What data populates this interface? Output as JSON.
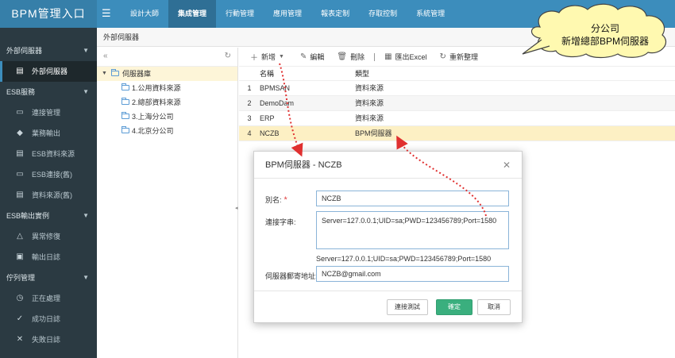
{
  "app": {
    "title": "BPM管理入口"
  },
  "topnav": [
    "設計大師",
    "集成管理",
    "行動管理",
    "應用管理",
    "報表定制",
    "存取控制",
    "系統管理"
  ],
  "sidebar": {
    "groups": [
      {
        "label": "外部伺服器",
        "items": [
          {
            "label": "外部伺服器",
            "icon": "database-icon",
            "active": true
          }
        ]
      },
      {
        "label": "ESB服務",
        "items": [
          {
            "label": "連接管理",
            "icon": "monitor-icon"
          },
          {
            "label": "業務輸出",
            "icon": "car-icon"
          },
          {
            "label": "ESB資料來源",
            "icon": "database-icon"
          },
          {
            "label": "ESB連接(舊)",
            "icon": "monitor-icon"
          },
          {
            "label": "資料來源(舊)",
            "icon": "database-icon"
          }
        ]
      },
      {
        "label": "ESB輸出實例",
        "items": [
          {
            "label": "異常修復",
            "icon": "warning-icon"
          },
          {
            "label": "輸出日誌",
            "icon": "log-icon"
          }
        ]
      },
      {
        "label": "佇列管理",
        "items": [
          {
            "label": "正在處理",
            "icon": "clock-icon"
          },
          {
            "label": "成功日誌",
            "icon": "check-icon"
          },
          {
            "label": "失敗日誌",
            "icon": "cross-icon"
          }
        ]
      }
    ]
  },
  "breadcrumb": "外部伺服器",
  "tree": {
    "root": "伺服器庫",
    "nodes": [
      "1.公用資料來源",
      "2.總部資料來源",
      "3.上海分公司",
      "4.北京分公司"
    ]
  },
  "toolbar": {
    "new": "新增",
    "edit": "編輯",
    "delete": "刪除",
    "export": "匯出Excel",
    "reset": "重新整理"
  },
  "grid": {
    "columns": [
      "名稱",
      "類型"
    ],
    "rows": [
      {
        "num": "1",
        "name": "BPMSAN",
        "type": "資料來源"
      },
      {
        "num": "2",
        "name": "DemoDam",
        "type": "資料來源"
      },
      {
        "num": "3",
        "name": "ERP",
        "type": "資料來源"
      },
      {
        "num": "4",
        "name": "NCZB",
        "type": "BPM伺服器",
        "selected": true
      }
    ]
  },
  "dialog": {
    "title": "BPM伺服器 - NCZB",
    "alias_label": "別名:",
    "alias_value": "NCZB",
    "conn_label": "連接字串:",
    "conn_value": "Server=127.0.0.1;UID=sa;PWD=123456789;Port=1580",
    "conn_preview": "Server=127.0.0.1;UID=sa;PWD=123456789;Port=1580",
    "email_label": "伺服器郵寄地址:",
    "email_value": "NCZB@gmail.com",
    "test_button": "連接測試",
    "ok_button": "確定",
    "cancel_button": "取消"
  },
  "callout": {
    "line1": "分公司",
    "line2": "新增總部BPM伺服器"
  },
  "colors": {
    "topbar": "#3c8dbc",
    "sidebar": "#2b3a42",
    "selected_row": "#fdf0c4",
    "primary_button": "#3aaf7e",
    "arrow": "#e03030"
  }
}
